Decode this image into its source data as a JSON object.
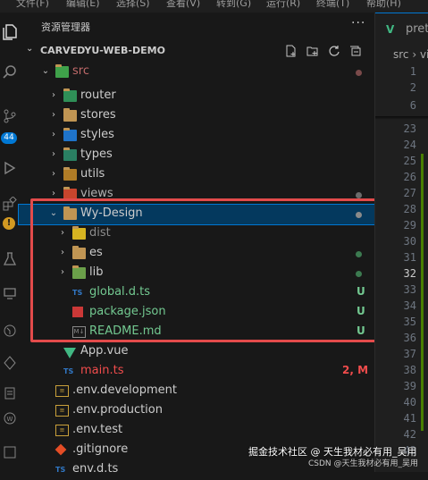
{
  "menubar": {
    "items": [
      "文件(F)",
      "编辑(E)",
      "选择(S)",
      "查看(V)",
      "转到(G)",
      "运行(R)",
      "终端(T)",
      "帮助(H)"
    ]
  },
  "activity_bar": {
    "icons": [
      "files-icon",
      "search-icon",
      "source-control-icon",
      "run-debug-icon",
      "extensions-icon",
      "testing-icon",
      "remote-icon",
      "git-graph-icon",
      "timeline-icon",
      "settings-icon",
      "webpack-icon"
    ],
    "source_control_badge": "44",
    "warning_badge": "!"
  },
  "explorer": {
    "title": "资源管理器",
    "more": "···",
    "project": "CARVEDYU-WEB-DEMO",
    "actions": [
      "new-file-icon",
      "new-folder-icon",
      "refresh-icon",
      "collapse-all-icon"
    ],
    "tree": [
      {
        "label": "src",
        "kind": "folder-src",
        "open": true,
        "depth": 1,
        "status_dot": "#7a4a4a"
      },
      {
        "label": "router",
        "kind": "folder-router",
        "open": false,
        "depth": 2
      },
      {
        "label": "stores",
        "kind": "folder",
        "open": false,
        "depth": 2
      },
      {
        "label": "styles",
        "kind": "folder-styles",
        "open": false,
        "depth": 2
      },
      {
        "label": "types",
        "kind": "folder-types",
        "open": false,
        "depth": 2
      },
      {
        "label": "utils",
        "kind": "folder-utils",
        "open": false,
        "depth": 2
      },
      {
        "label": "views",
        "kind": "folder-views",
        "open": false,
        "depth": 2,
        "status_dot": "#6b6b6b"
      },
      {
        "label": "Wy-Design",
        "kind": "folder",
        "open": true,
        "depth": 2,
        "status_dot": "#8a8a8a",
        "selected": true
      },
      {
        "label": "dist",
        "kind": "folder-dist",
        "open": false,
        "depth": 3,
        "muted": true
      },
      {
        "label": "es",
        "kind": "folder",
        "open": false,
        "depth": 3,
        "status_dot": "#3c7a50"
      },
      {
        "label": "lib",
        "kind": "folder-lib",
        "open": false,
        "depth": 3,
        "status_dot": "#3c7a50"
      },
      {
        "label": "global.d.ts",
        "kind": "ts",
        "depth": 3,
        "status": "U"
      },
      {
        "label": "package.json",
        "kind": "npm",
        "depth": 3,
        "status": "U"
      },
      {
        "label": "README.md",
        "kind": "md",
        "depth": 3,
        "status": "U"
      },
      {
        "label": "App.vue",
        "kind": "vue",
        "depth": 2
      },
      {
        "label": "main.ts",
        "kind": "ts",
        "depth": 2,
        "status": "2, M",
        "modified": true
      },
      {
        "label": ".env.development",
        "kind": "env",
        "depth": 1
      },
      {
        "label": ".env.production",
        "kind": "env",
        "depth": 1
      },
      {
        "label": ".env.test",
        "kind": "env",
        "depth": 1
      },
      {
        "label": ".gitignore",
        "kind": "git",
        "depth": 1
      },
      {
        "label": "env.d.ts",
        "kind": "ts",
        "depth": 1
      }
    ]
  },
  "editor": {
    "tab_label": "pret",
    "tab_icon": "V",
    "breadcrumb": "src › vi",
    "line_numbers": [
      "1",
      "2",
      "6",
      "23",
      "24",
      "25",
      "26",
      "27",
      "28",
      "29",
      "30",
      "31",
      "32",
      "33",
      "34",
      "35",
      "36",
      "37",
      "38",
      "39",
      "40",
      "41",
      "42",
      "43"
    ],
    "current_line": "32"
  },
  "watermark": {
    "line1": "掘金技术社区 @ 天生我材必有用_吴用",
    "line2": "CSDN @天生我材必有用_吴用"
  },
  "colors": {
    "accent": "#0078d4",
    "highlight_box": "#e34b4b",
    "untracked": "#73c991",
    "modified": "#e2c08d",
    "error_count": "#f14c4c"
  }
}
